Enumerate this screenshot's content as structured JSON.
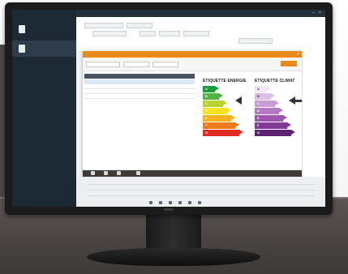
{
  "app": {
    "window_title": "",
    "sidebar": {
      "items": [
        {
          "label": ""
        },
        {
          "label": ""
        }
      ],
      "subitems": [
        "",
        "",
        ""
      ],
      "footer": ""
    }
  },
  "dialog": {
    "title": "",
    "search_button": "",
    "table": {
      "columns": [
        "",
        "",
        "",
        ""
      ],
      "rows": [
        [
          "",
          "",
          "",
          ""
        ],
        [
          "",
          "",
          "",
          ""
        ],
        [
          "",
          "",
          "",
          ""
        ],
        [
          "",
          "",
          "",
          ""
        ]
      ]
    }
  },
  "energy_labels": [
    {
      "title": "ETIQUETTE ENERGIE",
      "subtitle": "",
      "classes": [
        "A",
        "B",
        "C",
        "D",
        "E",
        "F",
        "G"
      ],
      "colors": [
        "#1b9b3b",
        "#54b241",
        "#b9d22f",
        "#f3e41d",
        "#f6b21b",
        "#ef7a1c",
        "#e02a22"
      ]
    },
    {
      "title": "ETIQUETTE CLIMAT",
      "subtitle": "",
      "classes": [
        "A",
        "B",
        "C",
        "D",
        "E",
        "F",
        "G"
      ],
      "colors": [
        "#f3e6f5",
        "#dcc0e3",
        "#c89bd2",
        "#b478c1",
        "#9d55ad",
        "#823a96",
        "#5e2273"
      ]
    }
  ],
  "colors": {
    "accent": "#e98a1d",
    "sidebar": "#1d2a35"
  }
}
